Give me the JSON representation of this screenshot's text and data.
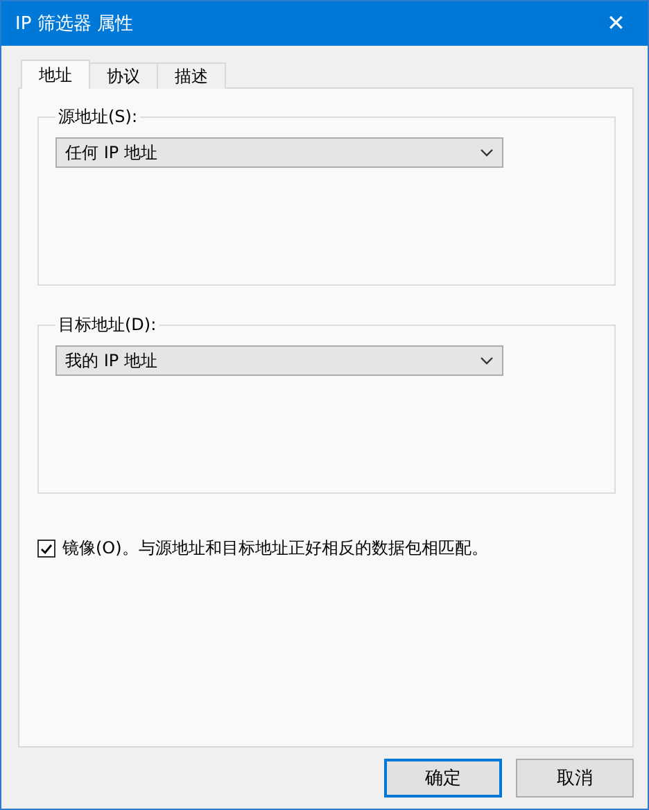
{
  "window": {
    "title": "IP 筛选器 属性",
    "close": "✕"
  },
  "tabs": [
    {
      "label": "地址",
      "selected": true
    },
    {
      "label": "协议",
      "selected": false
    },
    {
      "label": "描述",
      "selected": false
    }
  ],
  "groups": [
    {
      "label": "源地址(S):",
      "value": "任何 IP 地址"
    },
    {
      "label": "目标地址(D):",
      "value": "我的 IP 地址"
    }
  ],
  "mirror": {
    "label": "镜像(O)。与源地址和目标地址正好相反的数据包相匹配。",
    "checked": true
  },
  "buttons": [
    {
      "label": "确定",
      "default": true
    },
    {
      "label": "取消",
      "default": false
    }
  ]
}
